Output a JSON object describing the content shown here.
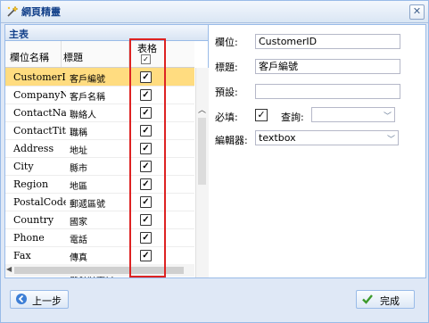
{
  "window": {
    "title": "網頁精靈",
    "close_icon": "close-icon"
  },
  "left_panel": {
    "header": "主表",
    "columns": {
      "field_name": "欄位名稱",
      "caption": "標題",
      "table": "表格"
    },
    "rows": [
      {
        "field": "CustomerID",
        "caption": "客戶編號",
        "checked": true,
        "selected": true
      },
      {
        "field": "CompanyName",
        "caption": "客戶名稱",
        "checked": true
      },
      {
        "field": "ContactName",
        "caption": "聯絡人",
        "checked": true
      },
      {
        "field": "ContactTitle",
        "caption": "職稱",
        "checked": true
      },
      {
        "field": "Address",
        "caption": "地址",
        "checked": true
      },
      {
        "field": "City",
        "caption": "縣市",
        "checked": true
      },
      {
        "field": "Region",
        "caption": "地區",
        "checked": true
      },
      {
        "field": "PostalCode",
        "caption": "郵遞區號",
        "checked": true
      },
      {
        "field": "Country",
        "caption": "國家",
        "checked": true
      },
      {
        "field": "Phone",
        "caption": "電話",
        "checked": true
      },
      {
        "field": "Fax",
        "caption": "傳真",
        "checked": true
      },
      {
        "field": "LastOrderedDate",
        "caption": "最近訂單日",
        "checked": true
      }
    ]
  },
  "right_panel": {
    "field_label": "欄位:",
    "field_value": "CustomerID",
    "caption_label": "標題:",
    "caption_value": "客戶編號",
    "default_label": "預設:",
    "default_value": "",
    "required_label": "必填:",
    "required_checked": true,
    "query_label": "查詢:",
    "query_value": "",
    "editor_label": "編輯器:",
    "editor_value": "textbox"
  },
  "footer": {
    "prev_label": "上一步",
    "finish_label": "完成"
  },
  "colors": {
    "selected_row": "#ffdc80",
    "highlight_box": "#dd2222",
    "title_text": "#15428b"
  }
}
